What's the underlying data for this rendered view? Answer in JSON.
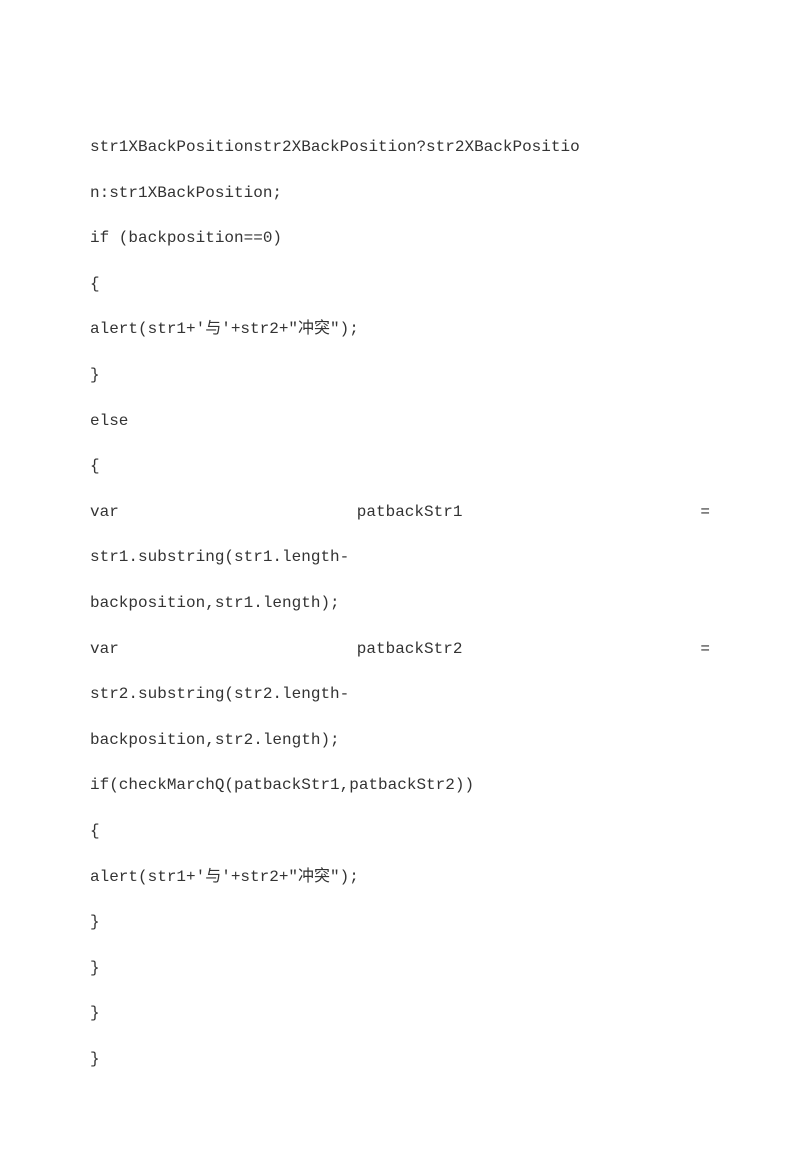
{
  "code": {
    "l1": "str1XBackPositionstr2XBackPosition?str2XBackPositio",
    "l2": "n:str1XBackPosition;",
    "l3": "         if (backposition==0)",
    "l4": "         {",
    "l5": "           alert(str1+'与'+str2+\"冲突\");",
    "l6": "         }",
    "l7": "         else",
    "l8": "         {",
    "l9_a": "            var",
    "l9_b": "patbackStr1",
    "l9_c": "=",
    "l10": "str1.substring(str1.length-",
    "l11": "backposition,str1.length);",
    "l12_a": "            var",
    "l12_b": "patbackStr2",
    "l12_c": "=",
    "l13": "str2.substring(str2.length-",
    "l14": "backposition,str2.length);",
    "l15": "           if(checkMarchQ(patbackStr1,patbackStr2))",
    "l16_blank": " ",
    "l17": "           {",
    "l18": "             alert(str1+'与'+str2+\"冲突\");",
    "l19": "           }",
    "l20": "         }",
    "l21": "       }",
    "l22": "      }"
  }
}
